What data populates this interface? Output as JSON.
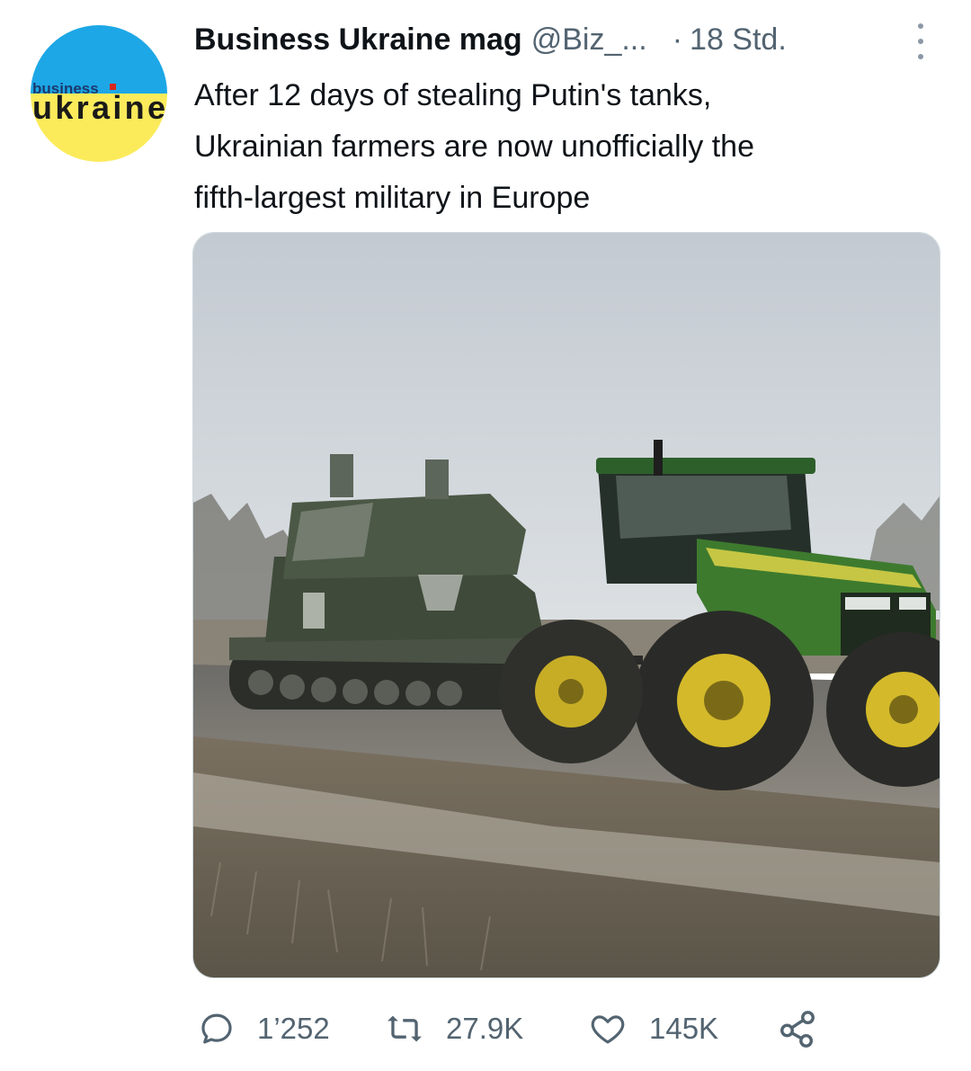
{
  "tweet": {
    "author_display_name": "Business Ukraine mag",
    "author_handle": "@Biz_...",
    "separator": "·",
    "timestamp": "18 Std.",
    "text_lines": [
      "After 12 days of stealing Putin's tanks,",
      "Ukrainian farmers are now unofficially the",
      "fifth-largest military in Europe"
    ],
    "avatar": {
      "logo_text_top": "business",
      "logo_text_bottom": "ukraine",
      "colors": {
        "top": "#1da7e6",
        "bottom": "#fbeb5b"
      }
    },
    "media": {
      "icon": "photo",
      "colors": {
        "tractor": "#3d7a2e",
        "wheels": "#d4b92a",
        "tank": "#3f4a3a"
      }
    },
    "actions": {
      "replies": {
        "icon": "reply-icon",
        "count": "1’252"
      },
      "retweets": {
        "icon": "retweet-icon",
        "count": "27.9K"
      },
      "likes": {
        "icon": "heart-icon",
        "count": "145K"
      },
      "share": {
        "icon": "share-icon"
      }
    }
  },
  "colors": {
    "text_primary": "#0f1419",
    "text_secondary": "#536471"
  }
}
